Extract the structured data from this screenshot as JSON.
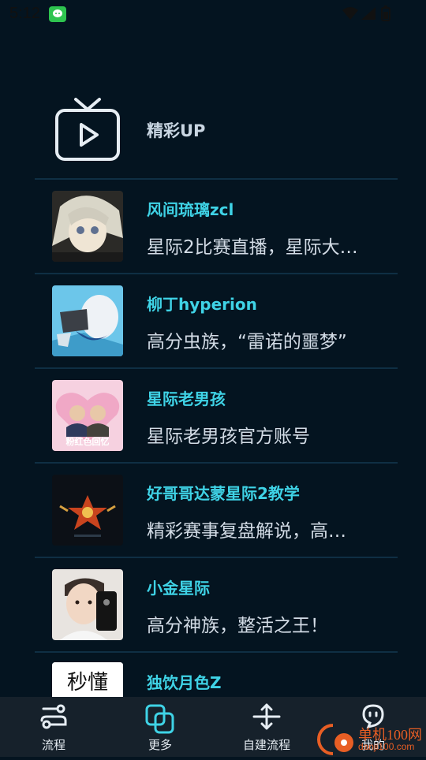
{
  "status": {
    "time": "5:12"
  },
  "header": {
    "title": "精彩UP"
  },
  "items": [
    {
      "name": "风间琉璃zcl",
      "desc": "星际2比赛直播，星际大…"
    },
    {
      "name": "柳丁hyperion",
      "desc": "高分虫族，“雷诺的噩梦”"
    },
    {
      "name": "星际老男孩",
      "desc": "星际老男孩官方账号",
      "avatar_text": "粉红色回忆"
    },
    {
      "name": "好哥哥达蒙星际2教学",
      "desc": "精彩赛事复盘解说，高…"
    },
    {
      "name": "小金星际",
      "desc": "高分神族，整活之王！"
    },
    {
      "name": "独饮月色Z",
      "desc": "",
      "avatar_text": "秒懂"
    }
  ],
  "nav": [
    {
      "label": "流程",
      "icon": "flow-icon"
    },
    {
      "label": "更多",
      "icon": "more-icon"
    },
    {
      "label": "自建流程",
      "icon": "custom-flow-icon"
    },
    {
      "label": "我的",
      "icon": "profile-icon"
    }
  ],
  "watermark": {
    "text": "单机100网",
    "url": "danji100.com"
  },
  "colors": {
    "background": "#041420",
    "accent": "#3fd3e6",
    "nav_bg": "#16212b"
  }
}
